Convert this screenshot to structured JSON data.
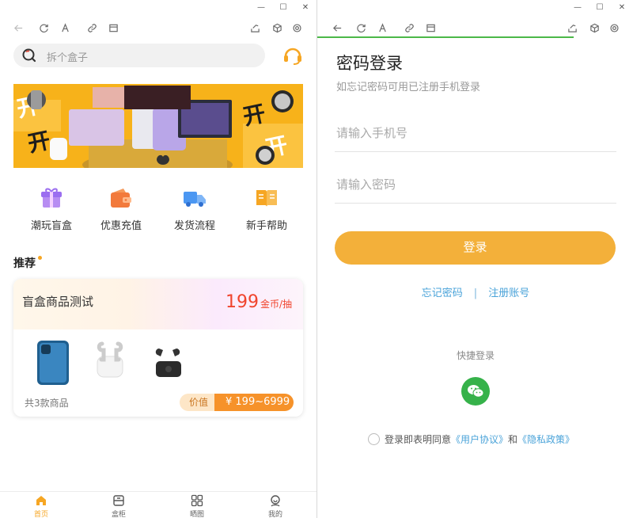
{
  "left": {
    "search": {
      "placeholder": "拆个盒子"
    },
    "categories": [
      {
        "label": "潮玩盲盒",
        "icon": "gift-icon"
      },
      {
        "label": "优惠充值",
        "icon": "wallet-icon"
      },
      {
        "label": "发货流程",
        "icon": "truck-icon"
      },
      {
        "label": "新手帮助",
        "icon": "book-icon"
      }
    ],
    "recommend_title": "推荐",
    "card": {
      "name": "盲盒商品测试",
      "price": "199",
      "price_unit": "金币/抽",
      "count": "共3款商品",
      "value_label": "价值",
      "value_range": "¥ 199~6999"
    },
    "bottom_nav": [
      {
        "label": "首页",
        "icon": "home-icon",
        "active": true
      },
      {
        "label": "盒柜",
        "icon": "box-cabinet-icon",
        "active": false
      },
      {
        "label": "晒图",
        "icon": "grid-icon",
        "active": false
      },
      {
        "label": "我的",
        "icon": "user-icon",
        "active": false
      }
    ]
  },
  "right": {
    "title": "密码登录",
    "subtitle": "如忘记密码可用已注册手机登录",
    "phone_placeholder": "请输入手机号",
    "password_placeholder": "请输入密码",
    "login_label": "登录",
    "forgot_label": "忘记密码",
    "separator": "|",
    "register_label": "注册账号",
    "quick_login_label": "快捷登录",
    "agree_prefix": "登录即表明同意",
    "agreement_label": "《用户协议》",
    "and_text": "和",
    "privacy_label": "《隐私政策》"
  },
  "colors": {
    "accent": "#f3b03a",
    "price_red": "#f0442d",
    "link_blue": "#4aa3d9",
    "wechat_green": "#36b24a",
    "progress_green": "#4cb848"
  }
}
